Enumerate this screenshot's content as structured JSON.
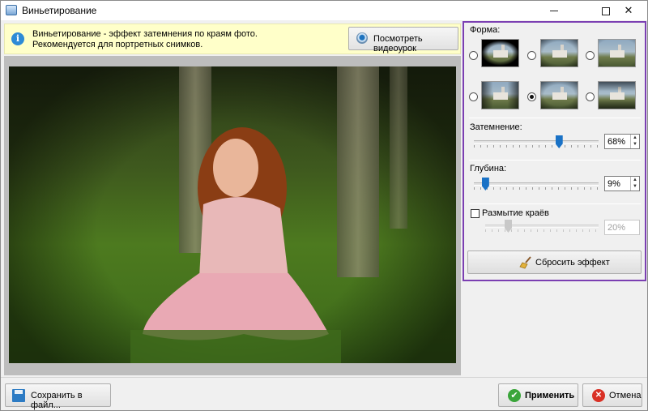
{
  "window": {
    "title": "Виньетирование",
    "minimize_icon": "minimize-icon",
    "maximize_icon": "maximize-icon",
    "close_glyph": "✕"
  },
  "info": {
    "icon": "info-icon",
    "icon_glyph": "i",
    "line1": "Виньетирование - эффект затемнения по краям фото.",
    "line2": "Рекомендуется для портретных снимков.",
    "video_button": "Посмотреть видеоурок"
  },
  "panel": {
    "shape_label": "Форма:",
    "shapes": [
      {
        "name": "shape-1",
        "selected": false
      },
      {
        "name": "shape-2",
        "selected": false
      },
      {
        "name": "shape-3",
        "selected": false
      },
      {
        "name": "shape-4",
        "selected": false
      },
      {
        "name": "shape-5",
        "selected": true
      },
      {
        "name": "shape-6",
        "selected": false
      }
    ],
    "darkening": {
      "label": "Затемнение:",
      "value": "68%",
      "level": 68
    },
    "depth": {
      "label": "Глубина:",
      "value": "9%",
      "level": 9
    },
    "edge_blur": {
      "label": "Размытие краёв",
      "checked": false,
      "value": "20%",
      "level": 20
    },
    "reset_button": "Сбросить эффект"
  },
  "footer": {
    "save_button": "Сохранить в файл...",
    "apply_button": "Применить",
    "cancel_button": "Отмена",
    "apply_glyph": "✔",
    "cancel_glyph": "✕"
  },
  "colors": {
    "panel_border": "#7b3fb2",
    "info_bg": "#ffffc9",
    "accent": "#1a72c6"
  }
}
